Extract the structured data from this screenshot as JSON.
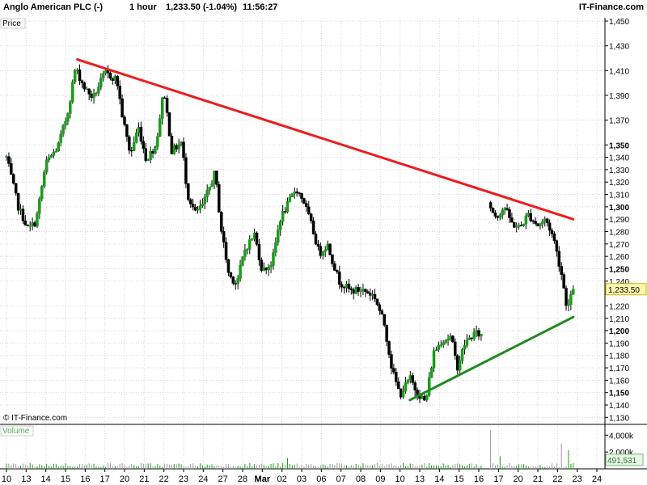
{
  "header": {
    "instrument": "Anglo American PLC (-)",
    "interval": "1 hour",
    "last_change": "1,233.50 (-1.04%)",
    "time": "11:56:27",
    "brand": "IT-Finance.com"
  },
  "panels": {
    "price_label": "Price",
    "volume_label": "Volume",
    "watermark": "© IT-Finance.com"
  },
  "chart_data": [
    {
      "type": "candlestick",
      "panel": "price",
      "y_scale": [
        1125,
        1452
      ],
      "y_ticks": [
        {
          "v": 1130,
          "label": "1,130",
          "bold": false
        },
        {
          "v": 1140,
          "label": "1,140",
          "bold": false
        },
        {
          "v": 1150,
          "label": "1,150",
          "bold": true
        },
        {
          "v": 1160,
          "label": "1,160",
          "bold": false
        },
        {
          "v": 1170,
          "label": "1,170",
          "bold": false
        },
        {
          "v": 1180,
          "label": "1,180",
          "bold": false
        },
        {
          "v": 1190,
          "label": "1,190",
          "bold": false
        },
        {
          "v": 1200,
          "label": "1,200",
          "bold": true
        },
        {
          "v": 1210,
          "label": "1,210",
          "bold": false
        },
        {
          "v": 1220,
          "label": "1,220",
          "bold": false
        },
        {
          "v": 1240,
          "label": "1,240",
          "bold": false
        },
        {
          "v": 1250,
          "label": "1,250",
          "bold": true
        },
        {
          "v": 1260,
          "label": "1,260",
          "bold": false
        },
        {
          "v": 1270,
          "label": "1,270",
          "bold": false
        },
        {
          "v": 1280,
          "label": "1,280",
          "bold": false
        },
        {
          "v": 1290,
          "label": "1,290",
          "bold": false
        },
        {
          "v": 1300,
          "label": "1,300",
          "bold": true
        },
        {
          "v": 1310,
          "label": "1,310",
          "bold": false
        },
        {
          "v": 1320,
          "label": "1,320",
          "bold": false
        },
        {
          "v": 1330,
          "label": "1,330",
          "bold": false
        },
        {
          "v": 1340,
          "label": "1,340",
          "bold": false
        },
        {
          "v": 1350,
          "label": "1,350",
          "bold": true
        },
        {
          "v": 1370,
          "label": "1,370",
          "bold": false
        },
        {
          "v": 1390,
          "label": "1,390",
          "bold": false
        },
        {
          "v": 1410,
          "label": "1,410",
          "bold": false
        },
        {
          "v": 1430,
          "label": "1,430",
          "bold": false
        },
        {
          "v": 1450,
          "label": "1,450",
          "bold": false
        }
      ],
      "last_price": {
        "value": 1233.5,
        "label": "1,233.50"
      },
      "x_labels": [
        {
          "label": "10",
          "bold": false
        },
        {
          "label": "13",
          "bold": false
        },
        {
          "label": "14",
          "bold": false
        },
        {
          "label": "15",
          "bold": false
        },
        {
          "label": "16",
          "bold": false
        },
        {
          "label": "17",
          "bold": false
        },
        {
          "label": "20",
          "bold": false
        },
        {
          "label": "21",
          "bold": false
        },
        {
          "label": "22",
          "bold": false
        },
        {
          "label": "23",
          "bold": false
        },
        {
          "label": "24",
          "bold": false
        },
        {
          "label": "27",
          "bold": false
        },
        {
          "label": "28",
          "bold": false
        },
        {
          "label": "Mar",
          "bold": true
        },
        {
          "label": "02",
          "bold": false
        },
        {
          "label": "03",
          "bold": false
        },
        {
          "label": "06",
          "bold": false
        },
        {
          "label": "07",
          "bold": false
        },
        {
          "label": "08",
          "bold": false
        },
        {
          "label": "09",
          "bold": false
        },
        {
          "label": "10",
          "bold": false
        },
        {
          "label": "13",
          "bold": false
        },
        {
          "label": "14",
          "bold": false
        },
        {
          "label": "15",
          "bold": false
        },
        {
          "label": "16",
          "bold": false
        },
        {
          "label": "17",
          "bold": false
        },
        {
          "label": "20",
          "bold": false
        },
        {
          "label": "21",
          "bold": false
        },
        {
          "label": "22",
          "bold": false
        },
        {
          "label": "23",
          "bold": false
        },
        {
          "label": "24",
          "bold": false
        }
      ],
      "price_path": [
        [
          0,
          1340
        ],
        [
          0.6,
          1300
        ],
        [
          1.1,
          1282
        ],
        [
          1.5,
          1288
        ],
        [
          2.0,
          1335
        ],
        [
          2.6,
          1348
        ],
        [
          3.1,
          1375
        ],
        [
          3.5,
          1412
        ],
        [
          4.0,
          1395
        ],
        [
          4.4,
          1388
        ],
        [
          5.0,
          1408
        ],
        [
          5.6,
          1403
        ],
        [
          5.9,
          1372
        ],
        [
          6.3,
          1342
        ],
        [
          6.7,
          1365
        ],
        [
          7.1,
          1338
        ],
        [
          7.6,
          1350
        ],
        [
          8.0,
          1395
        ],
        [
          8.4,
          1345
        ],
        [
          8.9,
          1352
        ],
        [
          9.2,
          1310
        ],
        [
          9.6,
          1295
        ],
        [
          10.0,
          1302
        ],
        [
          10.6,
          1328
        ],
        [
          10.9,
          1283
        ],
        [
          11.3,
          1245
        ],
        [
          11.7,
          1238
        ],
        [
          12.1,
          1265
        ],
        [
          12.6,
          1278
        ],
        [
          13.0,
          1248
        ],
        [
          13.5,
          1255
        ],
        [
          13.9,
          1290
        ],
        [
          14.3,
          1302
        ],
        [
          14.7,
          1315
        ],
        [
          15.1,
          1305
        ],
        [
          15.5,
          1285
        ],
        [
          15.9,
          1262
        ],
        [
          16.3,
          1270
        ],
        [
          16.9,
          1240
        ],
        [
          17.5,
          1232
        ],
        [
          18.1,
          1233
        ],
        [
          18.7,
          1228
        ],
        [
          19.2,
          1205
        ],
        [
          19.6,
          1168
        ],
        [
          20.0,
          1148
        ],
        [
          20.5,
          1162
        ],
        [
          20.8,
          1152
        ],
        [
          21.3,
          1142
        ],
        [
          21.7,
          1182
        ],
        [
          22.1,
          1192
        ],
        [
          22.6,
          1195
        ],
        [
          22.9,
          1170
        ],
        [
          23.3,
          1190
        ],
        [
          23.8,
          1198
        ],
        [
          24.2,
          1196
        ],
        [
          24.5,
          1302
        ],
        [
          24.9,
          1292
        ],
        [
          25.3,
          1300
        ],
        [
          25.7,
          1286
        ],
        [
          26.1,
          1283
        ],
        [
          26.5,
          1294
        ],
        [
          27.0,
          1285
        ],
        [
          27.4,
          1290
        ],
        [
          27.8,
          1275
        ],
        [
          28.2,
          1246
        ],
        [
          28.5,
          1217
        ],
        [
          28.8,
          1233.5
        ]
      ],
      "trendlines": [
        {
          "name": "resistance",
          "color": "#ee1c1c",
          "from": [
            3.6,
            1419
          ],
          "to": [
            28.8,
            1290
          ]
        },
        {
          "name": "support",
          "color": "#1e8c1e",
          "from": [
            20.5,
            1144
          ],
          "to": [
            28.8,
            1211
          ]
        }
      ],
      "colors": {
        "up": "#1a9c1a",
        "down": "#000000",
        "grid": "#d8d8d8"
      }
    },
    {
      "type": "bar",
      "panel": "volume",
      "y_scale": [
        0,
        4800000
      ],
      "y_ticks": [
        {
          "v": 4000000,
          "label": "4,000k"
        },
        {
          "v": 2000000,
          "label": "2,000k"
        }
      ],
      "last_volume": {
        "value": 491531,
        "label": "491,531"
      },
      "spikes": [
        {
          "x": 24.55,
          "v": 4600000
        },
        {
          "x": 28.25,
          "v": 3000000
        },
        {
          "x": 28.55,
          "v": 2200000
        },
        {
          "x": 25.1,
          "v": 1500000
        },
        {
          "x": 14.3,
          "v": 1300000
        }
      ]
    }
  ]
}
